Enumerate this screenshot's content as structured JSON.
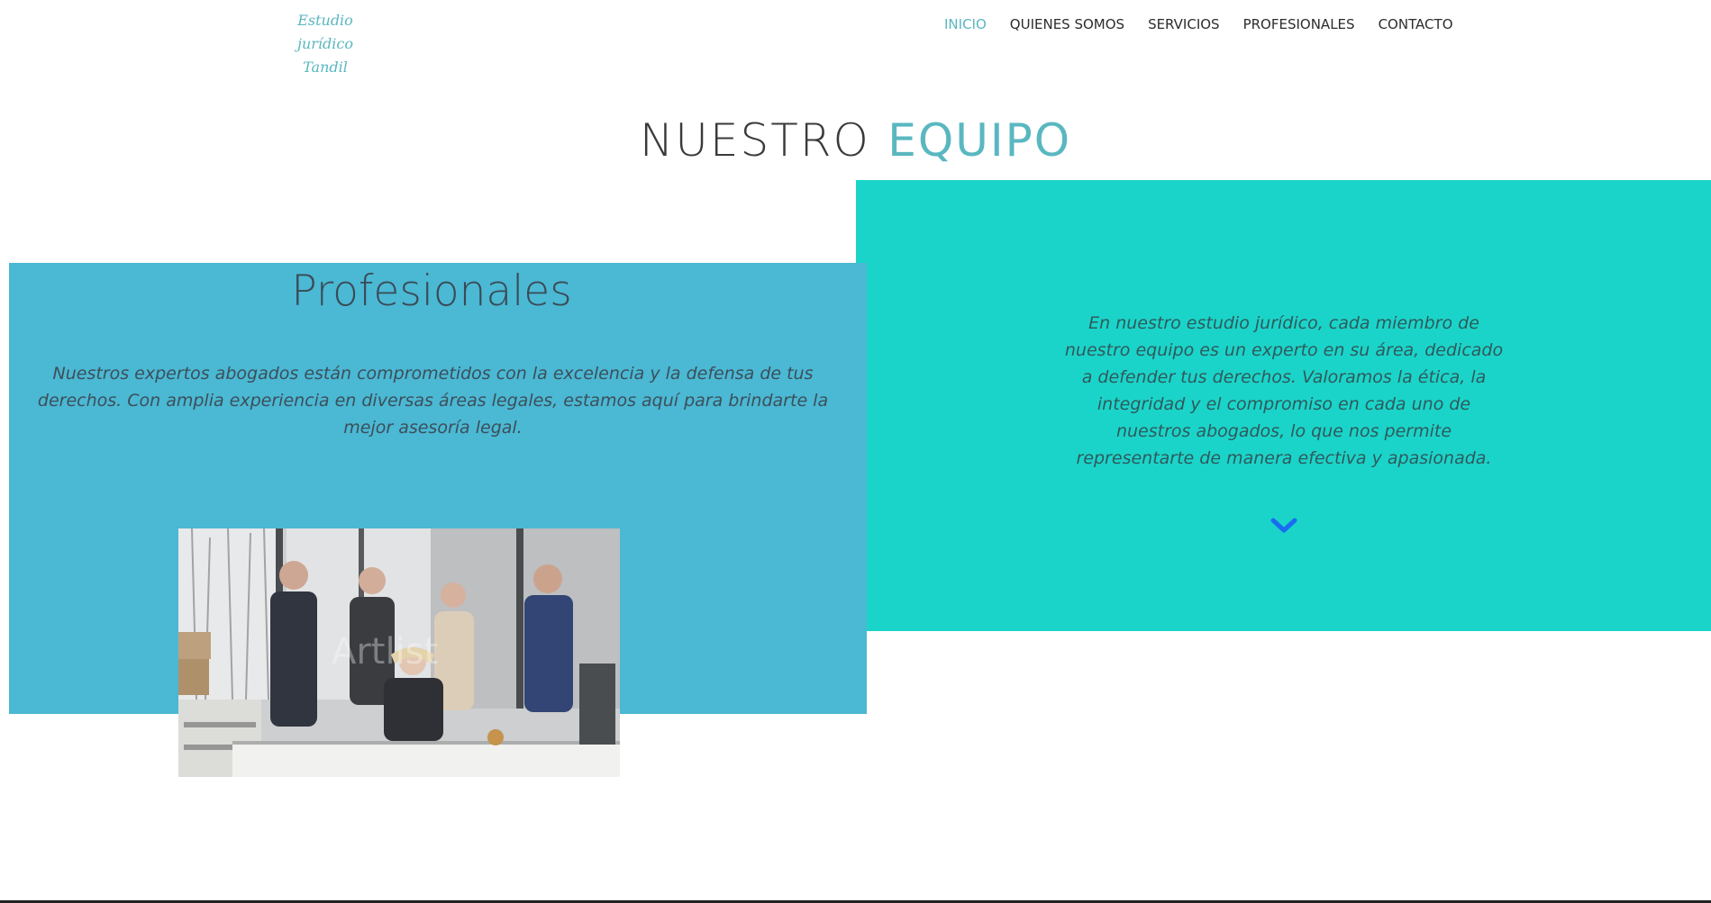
{
  "header": {
    "logo_line1": "Estudio jurídico",
    "logo_line2": "Tandil",
    "nav": [
      {
        "label": "INICIO",
        "active": true
      },
      {
        "label": "QUIENES SOMOS",
        "active": false
      },
      {
        "label": "SERVICIOS",
        "active": false
      },
      {
        "label": "PROFESIONALES",
        "active": false
      },
      {
        "label": "CONTACTO",
        "active": false
      }
    ]
  },
  "section": {
    "title_part1": "NUESTRO",
    "title_part2": "EQUIPO"
  },
  "left_panel": {
    "title": "Profesionales",
    "text": "Nuestros expertos abogados están comprometidos con la excelencia y la defensa de tus derechos. Con amplia experiencia en diversas áreas legales, estamos aquí para brindarte la mejor asesoría legal.",
    "image_watermark": "Artlist"
  },
  "right_panel": {
    "text": "En nuestro estudio jurídico, cada miembro de nuestro equipo es un experto en su área, dedicado a defender tus derechos. Valoramos la ética, la integridad y el compromiso en cada uno de nuestros abogados, lo que nos permite representarte de manera efectiva y apasionada.",
    "scroll_icon": "chevron-down-icon"
  },
  "colors": {
    "accent": "#5ab7c0",
    "left_panel_bg": "#4bb8d4",
    "right_panel_bg": "#1bd4c9",
    "chevron": "#1a6cf0"
  }
}
